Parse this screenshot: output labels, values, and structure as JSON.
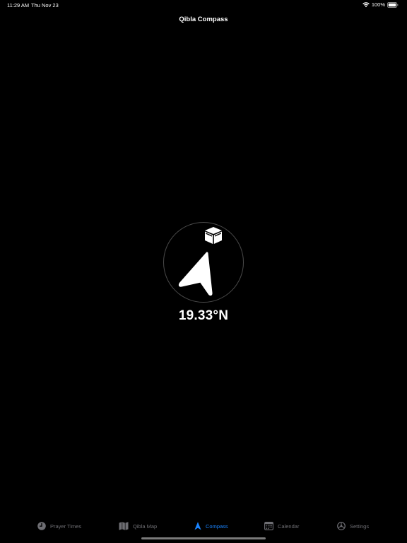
{
  "status_bar": {
    "time": "11:29 AM",
    "date": "Thu Nov 23",
    "battery": "100%"
  },
  "nav": {
    "title": "Qibla Compass"
  },
  "compass": {
    "latitude": "19.33°N"
  },
  "tabs": [
    {
      "label": "Prayer Times",
      "icon": "clock-icon",
      "active": false
    },
    {
      "label": "Qibla Map",
      "icon": "map-icon",
      "active": false
    },
    {
      "label": "Compass",
      "icon": "location-arrow-icon",
      "active": true
    },
    {
      "label": "Calendar",
      "icon": "calendar-icon",
      "active": false
    },
    {
      "label": "Settings",
      "icon": "gear-icon",
      "active": false
    }
  ],
  "colors": {
    "background": "#000000",
    "active_tab": "#1a84ff",
    "inactive_tab": "#6e6e73"
  }
}
